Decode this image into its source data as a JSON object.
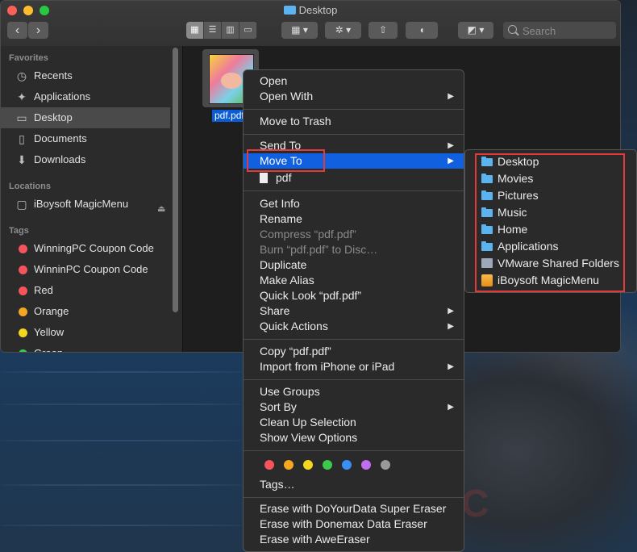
{
  "window": {
    "title": "Desktop"
  },
  "toolbar": {
    "back": "‹",
    "forward": "›",
    "search_placeholder": "Search"
  },
  "sidebar": {
    "favorites_header": "Favorites",
    "favorites": [
      {
        "label": "Recents",
        "icon": "clock-icon"
      },
      {
        "label": "Applications",
        "icon": "applications-icon"
      },
      {
        "label": "Desktop",
        "icon": "desktop-icon",
        "selected": true
      },
      {
        "label": "Documents",
        "icon": "document-icon"
      },
      {
        "label": "Downloads",
        "icon": "download-icon"
      }
    ],
    "locations_header": "Locations",
    "locations": [
      {
        "label": "iBoysoft MagicMenu",
        "icon": "disk-icon"
      }
    ],
    "tags_header": "Tags",
    "tags": [
      {
        "label": "WinningPC Coupon Code",
        "color": "#f4545a"
      },
      {
        "label": "WinninPC Coupon Code",
        "color": "#f4545a"
      },
      {
        "label": "Red",
        "color": "#f4545a"
      },
      {
        "label": "Orange",
        "color": "#f5a623"
      },
      {
        "label": "Yellow",
        "color": "#f3d61d"
      },
      {
        "label": "Green",
        "color": "#3dc94e"
      }
    ]
  },
  "file": {
    "name": "pdf.pdf"
  },
  "context_menu": {
    "open": "Open",
    "open_with": "Open With",
    "move_to_trash": "Move to Trash",
    "send_to": "Send To",
    "move_to": "Move To",
    "pdf": "pdf",
    "get_info": "Get Info",
    "rename": "Rename",
    "compress": "Compress “pdf.pdf”",
    "burn": "Burn “pdf.pdf” to Disc…",
    "duplicate": "Duplicate",
    "make_alias": "Make Alias",
    "quick_look": "Quick Look “pdf.pdf”",
    "share": "Share",
    "quick_actions": "Quick Actions",
    "copy": "Copy “pdf.pdf”",
    "import": "Import from iPhone or iPad",
    "use_groups": "Use Groups",
    "sort_by": "Sort By",
    "clean_up": "Clean Up Selection",
    "show_view_options": "Show View Options",
    "tag_colors": [
      "#f4545a",
      "#f5a623",
      "#f3d61d",
      "#3dc94e",
      "#3a8ef5",
      "#c06ef0",
      "#9a9a9a"
    ],
    "tags": "Tags…",
    "erase1": "Erase with DoYourData Super Eraser",
    "erase2": "Erase with Donemax Data Eraser",
    "erase3": "Erase with AweEraser"
  },
  "submenu": [
    {
      "label": "Desktop",
      "icon": "folder-icon"
    },
    {
      "label": "Movies",
      "icon": "folder-icon"
    },
    {
      "label": "Pictures",
      "icon": "folder-icon"
    },
    {
      "label": "Music",
      "icon": "folder-icon"
    },
    {
      "label": "Home",
      "icon": "folder-icon"
    },
    {
      "label": "Applications",
      "icon": "folder-icon"
    },
    {
      "label": "VMware Shared Folders",
      "icon": "vmware-icon"
    },
    {
      "label": "iBoysoft MagicMenu",
      "icon": "drive-icon"
    }
  ]
}
